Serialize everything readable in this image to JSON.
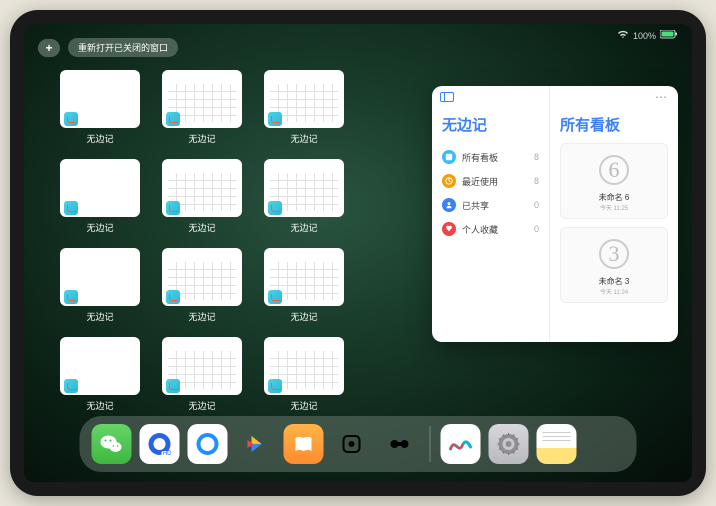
{
  "status": {
    "battery": "100%"
  },
  "topbar": {
    "plus": "+",
    "reopen_label": "重新打开已关闭的窗口"
  },
  "app": {
    "name": "无边记"
  },
  "thumbnails": {
    "rows": [
      [
        "blank",
        "calendar",
        "calendar"
      ],
      [
        "blank",
        "calendar",
        "calendar"
      ],
      [
        "blank",
        "calendar",
        "calendar"
      ],
      [
        "blank",
        "calendar",
        "calendar"
      ]
    ]
  },
  "panel": {
    "sidebar": {
      "title": "无边记",
      "items": [
        {
          "label": "所有看板",
          "count": "8",
          "color": "#38bdf8"
        },
        {
          "label": "最近使用",
          "count": "8",
          "color": "#f59e0b"
        },
        {
          "label": "已共享",
          "count": "0",
          "color": "#3b82f6"
        },
        {
          "label": "个人收藏",
          "count": "0",
          "color": "#ef4444"
        }
      ]
    },
    "content": {
      "title": "所有看板",
      "boards": [
        {
          "title": "未命名 6",
          "sub": "今天 11:25",
          "digit": "6"
        },
        {
          "title": "未命名 3",
          "sub": "今天 11:24",
          "digit": "3"
        }
      ]
    }
  },
  "dock": {
    "apps": [
      {
        "name": "wechat"
      },
      {
        "name": "qq-hd"
      },
      {
        "name": "qq"
      },
      {
        "name": "play-video"
      },
      {
        "name": "books"
      },
      {
        "name": "dice-game"
      },
      {
        "name": "media-app"
      }
    ],
    "recent": [
      {
        "name": "freeform"
      },
      {
        "name": "settings"
      },
      {
        "name": "notes"
      },
      {
        "name": "app-library"
      }
    ]
  }
}
